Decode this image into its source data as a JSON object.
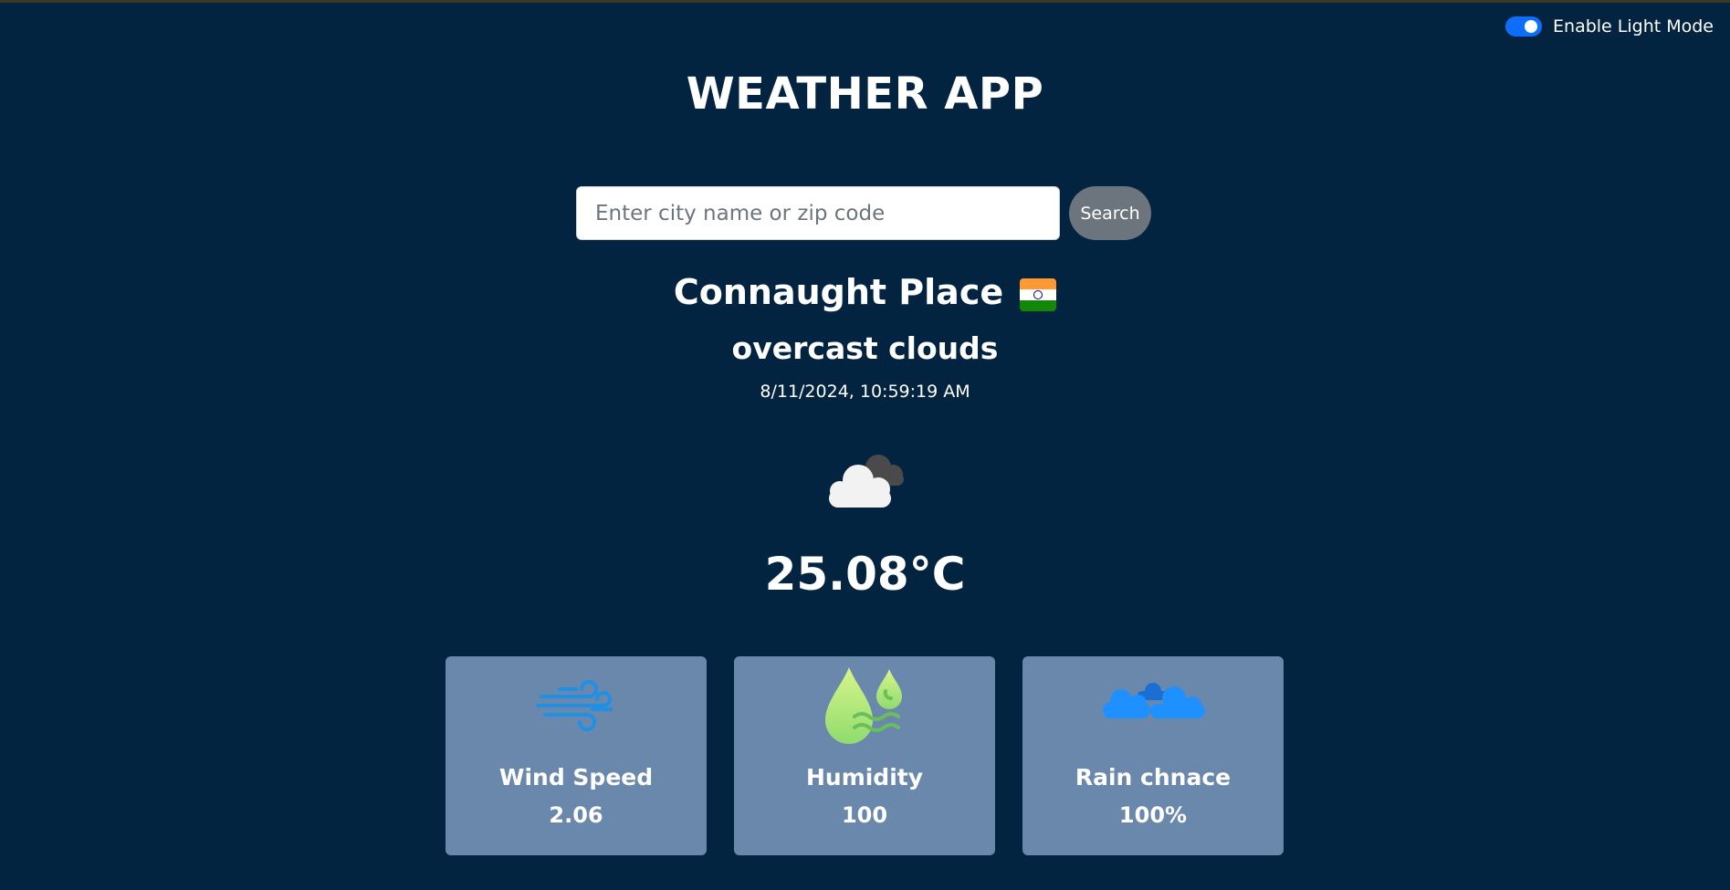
{
  "theme_toggle": {
    "label": "Enable Light Mode",
    "enabled": true,
    "accent_color": "#0d6efd"
  },
  "header": {
    "title": "WEATHER APP"
  },
  "search": {
    "placeholder": "Enter city name or zip code",
    "value": "",
    "button_label": "Search"
  },
  "location": {
    "city": "Connaught Place",
    "flag_icon": "india-flag-icon"
  },
  "weather": {
    "description": "overcast clouds",
    "datetime": "8/11/2024, 10:59:19 AM",
    "icon": "overcast-clouds-icon",
    "temperature": "25.08°C"
  },
  "stats": [
    {
      "icon": "wind-icon",
      "title": "Wind Speed",
      "value": "2.06"
    },
    {
      "icon": "humidity-icon",
      "title": "Humidity",
      "value": "100"
    },
    {
      "icon": "rain-cloud-icon",
      "title": "Rain chnace",
      "value": "100%"
    }
  ],
  "colors": {
    "background": "#022441",
    "card": "#6a88ab",
    "search_button": "#6c757d"
  }
}
